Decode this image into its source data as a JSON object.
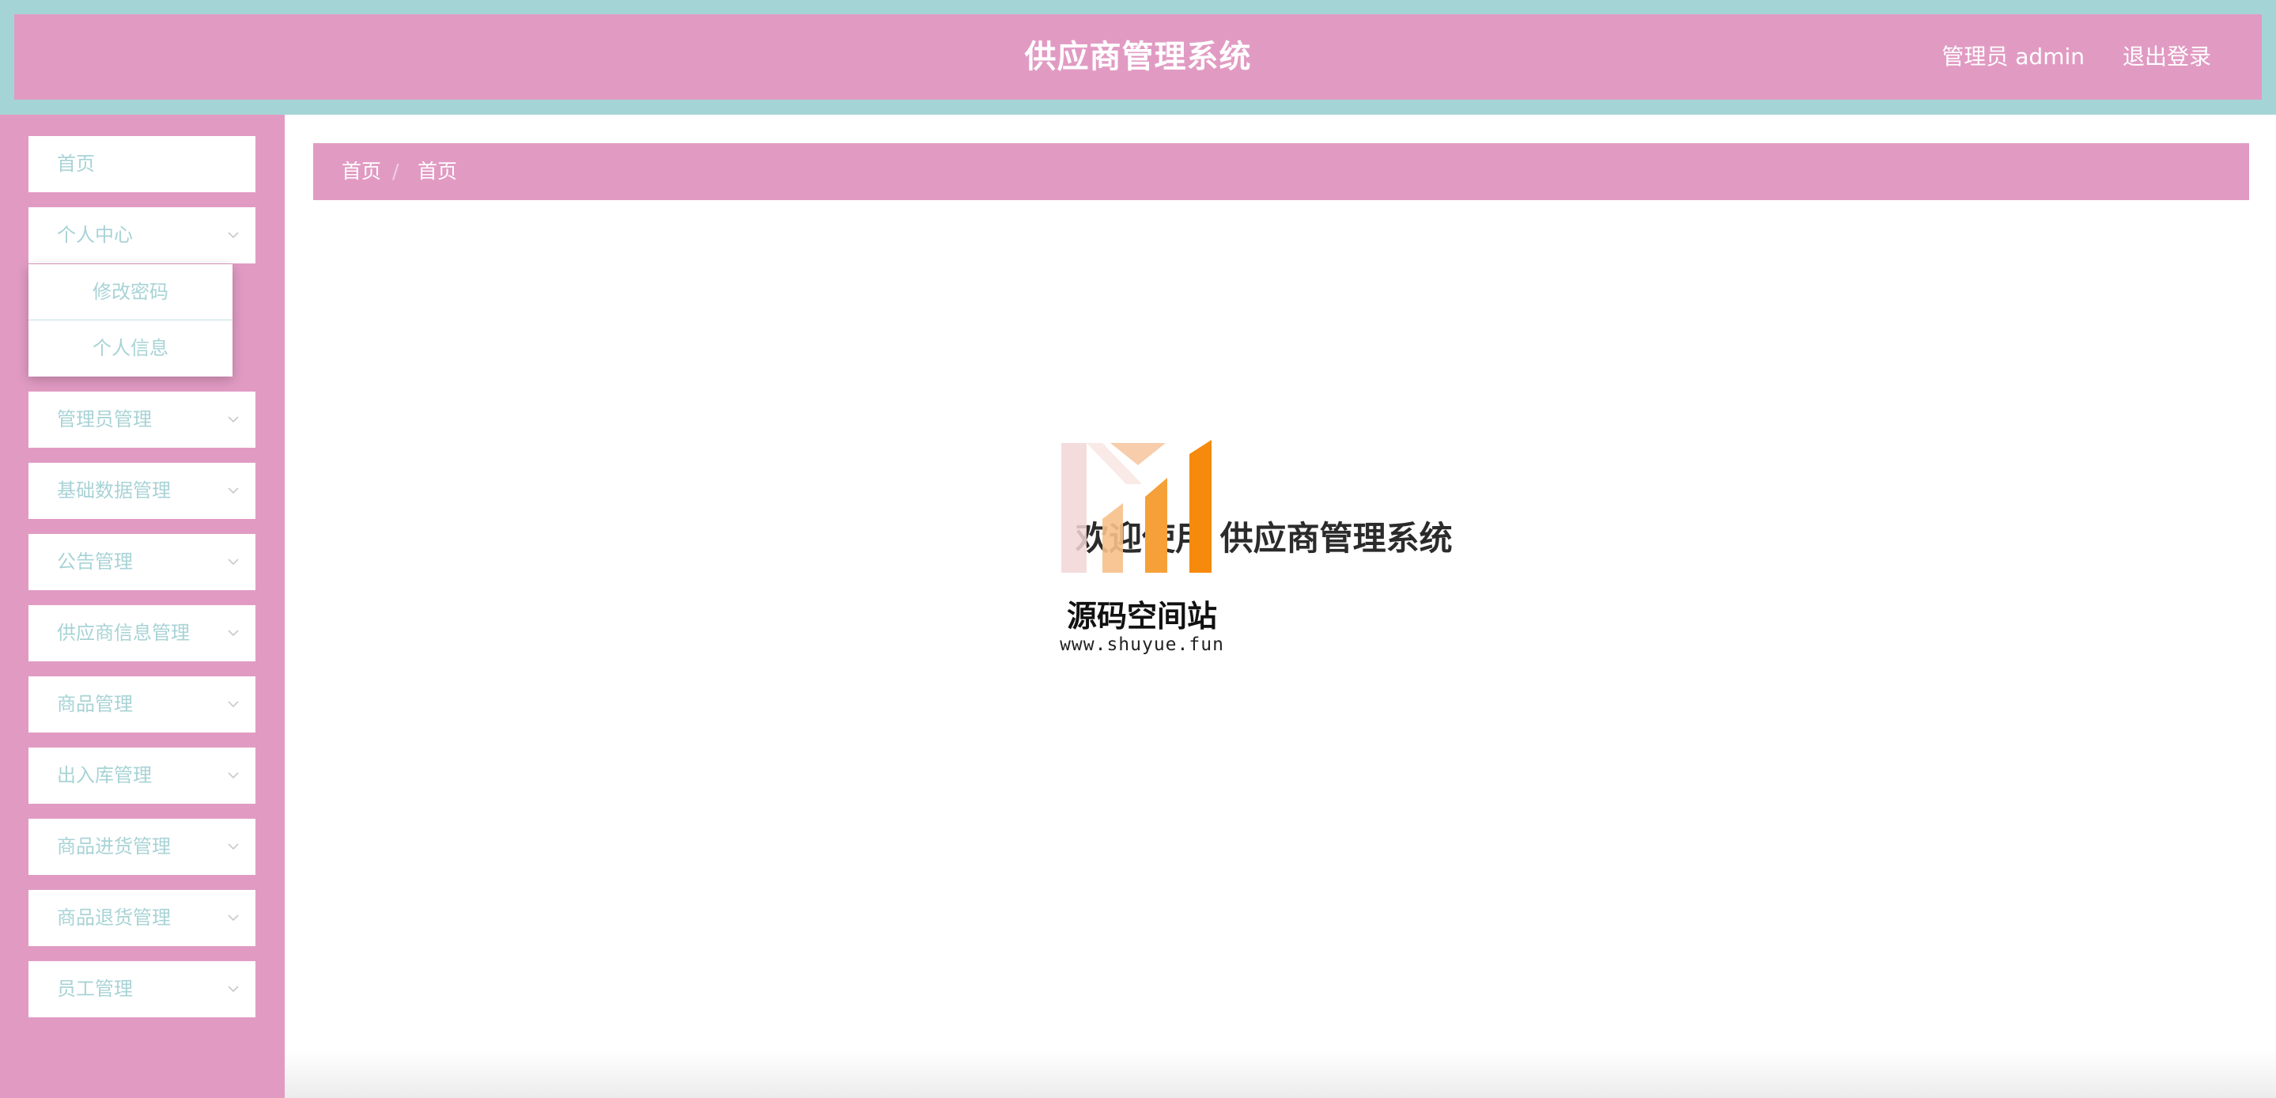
{
  "header": {
    "title": "供应商管理系统",
    "user": "管理员 admin",
    "logout": "退出登录"
  },
  "sidebar": {
    "items": [
      {
        "label": "首页"
      },
      {
        "label": "个人中心",
        "expanded": true,
        "children": [
          {
            "label": "修改密码"
          },
          {
            "label": "个人信息"
          }
        ]
      },
      {
        "label": "管理员管理"
      },
      {
        "label": "基础数据管理"
      },
      {
        "label": "公告管理"
      },
      {
        "label": "供应商信息管理"
      },
      {
        "label": "商品管理"
      },
      {
        "label": "出入库管理"
      },
      {
        "label": "商品进货管理"
      },
      {
        "label": "商品退货管理"
      },
      {
        "label": "员工管理"
      }
    ]
  },
  "breadcrumb": [
    "首页",
    "首页"
  ],
  "breadcrumb_separator": "/",
  "main": {
    "welcome": "欢迎使用 供应商管理系统"
  },
  "watermark": {
    "name": "源码空间站",
    "url": "www.shuyue.fun"
  },
  "colors": {
    "header_outer": "#a5d4d6",
    "primary_pink": "#e19bc3",
    "menu_text": "#a8d3d6",
    "white": "#ffffff"
  }
}
